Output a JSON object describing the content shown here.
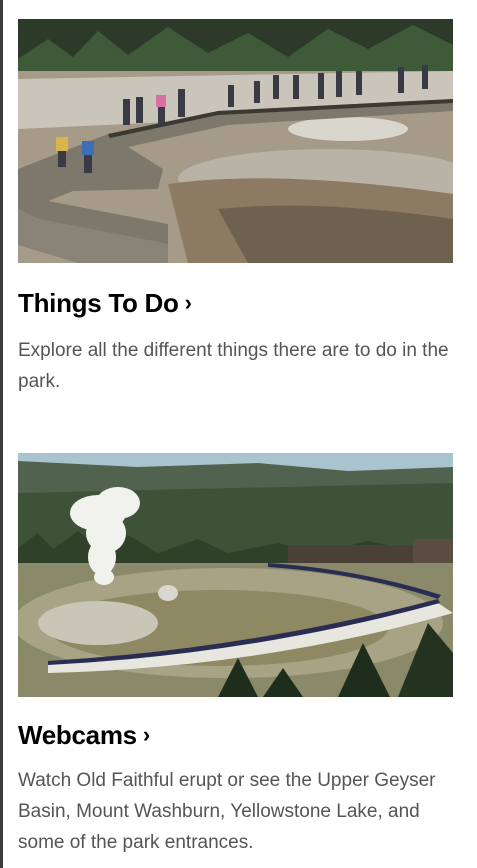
{
  "cards": [
    {
      "title": "Things To Do",
      "chevron": "›",
      "description": "Explore all the different things there are to do in the park.",
      "image_icon": "boardwalk-geyser-basin-photo"
    },
    {
      "title": "Webcams",
      "chevron": "›",
      "description": "Watch Old Faithful erupt or see the Upper Geyser Basin, Mount Washburn, Yellowstone Lake, and some of the park entrances.",
      "image_icon": "old-faithful-eruption-photo"
    }
  ]
}
